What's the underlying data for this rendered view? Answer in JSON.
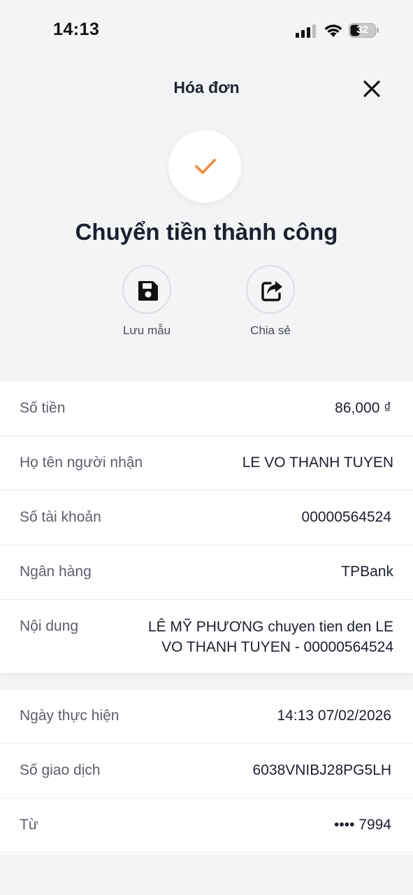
{
  "status_bar": {
    "time": "14:13",
    "battery": "32"
  },
  "header": {
    "title": "Hóa đơn"
  },
  "success": {
    "title": "Chuyển tiền thành công"
  },
  "actions": {
    "save_label": "Lưu mẫu",
    "share_label": "Chia sẻ"
  },
  "details": {
    "amount_label": "Số tiền",
    "amount_value": "86,000 ₫",
    "recipient_label": "Họ tên người nhận",
    "recipient_value": "LE VO THANH TUYEN",
    "account_label": "Số tài khoản",
    "account_value": "00000564524",
    "bank_label": "Ngân hàng",
    "bank_value": "TPBank",
    "content_label": "Nội dung",
    "content_value_line1": "LÊ MỸ PHƯƠNG chuyen tien den LE",
    "content_value_line2": "VO THANH TUYEN - 00000564524"
  },
  "transaction": {
    "date_label": "Ngày thực hiện",
    "date_value": "14:13 07/02/2026",
    "id_label": "Số giao dịch",
    "id_value": "6038VNIBJ28PG5LH",
    "from_label": "Từ",
    "from_value": "•••• 7994"
  },
  "colors": {
    "accent": "#f08a3c",
    "background": "#f3f4f6",
    "text": "#1b1f2e"
  }
}
